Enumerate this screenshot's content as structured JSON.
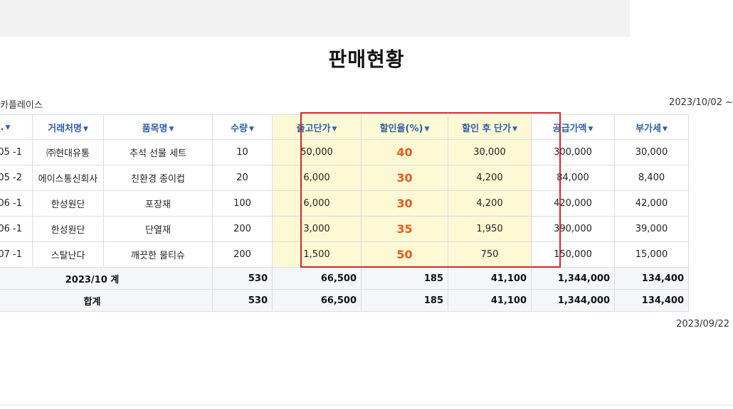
{
  "report": {
    "title": "판매현황",
    "company": "카플레이스",
    "date_range": "2023/10/02 ~",
    "print_date": "2023/09/22"
  },
  "table": {
    "headers": [
      "o.",
      "거래처명",
      "품목명",
      "수량",
      "출고단가",
      "할인율(%)",
      "할인 후 단가",
      "공급가액",
      "부가세"
    ],
    "sort_icon": "triangle-down-icon",
    "rows": [
      {
        "no": "05 -1",
        "customer": "㈜현대유통",
        "item": "추석 선물 세트",
        "qty": "10",
        "unit_price": "50,000",
        "discount": "40",
        "after_price": "30,000",
        "supply": "300,000",
        "vat": "30,000"
      },
      {
        "no": "05 -2",
        "customer": "에이스통신회사",
        "item": "친환경 종이컵",
        "qty": "20",
        "unit_price": "6,000",
        "discount": "30",
        "after_price": "4,200",
        "supply": "84,000",
        "vat": "8,400"
      },
      {
        "no": "06 -1",
        "customer": "한성원단",
        "item": "포장재",
        "qty": "100",
        "unit_price": "6,000",
        "discount": "30",
        "after_price": "4,200",
        "supply": "420,000",
        "vat": "42,000"
      },
      {
        "no": "06 -1",
        "customer": "한성원단",
        "item": "단열재",
        "qty": "200",
        "unit_price": "3,000",
        "discount": "35",
        "after_price": "1,950",
        "supply": "390,000",
        "vat": "39,000"
      },
      {
        "no": "07 -1",
        "customer": "스탈난다",
        "item": "깨끗한 물티슈",
        "qty": "200",
        "unit_price": "1,500",
        "discount": "50",
        "after_price": "750",
        "supply": "150,000",
        "vat": "15,000"
      }
    ],
    "subtotal": {
      "label": "2023/10 계",
      "qty": "530",
      "unit_price": "66,500",
      "discount": "185",
      "after_price": "41,100",
      "supply": "1,344,000",
      "vat": "134,400"
    },
    "total": {
      "label": "합계",
      "qty": "530",
      "unit_price": "66,500",
      "discount": "185",
      "after_price": "41,100",
      "supply": "1,344,000",
      "vat": "134,400"
    }
  },
  "colors": {
    "header_text": "#2f5fa8",
    "highlight_bg": "#fdf9d4",
    "highlight_border": "#d9242a",
    "discount_text": "#e45a1f"
  }
}
